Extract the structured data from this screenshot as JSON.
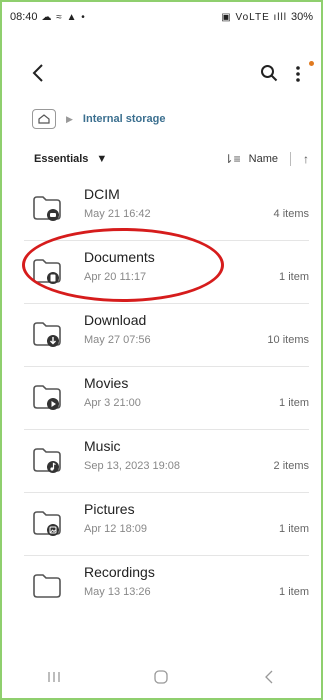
{
  "status": {
    "time": "08:40",
    "left_icons": "☁ ≈ ▲ •",
    "right_icons": "▣ VoLTE ılll",
    "battery": "30%"
  },
  "breadcrumb": {
    "label": "Internal storage"
  },
  "sortbar": {
    "filter_label": "Essentials",
    "sort_label": "Name"
  },
  "items": [
    {
      "name": "DCIM",
      "date": "May 21 16:42",
      "count": "4 items"
    },
    {
      "name": "Documents",
      "date": "Apr 20 11:17",
      "count": "1 item"
    },
    {
      "name": "Download",
      "date": "May 27 07:56",
      "count": "10 items"
    },
    {
      "name": "Movies",
      "date": "Apr 3 21:00",
      "count": "1 item"
    },
    {
      "name": "Music",
      "date": "Sep 13, 2023 19:08",
      "count": "2 items"
    },
    {
      "name": "Pictures",
      "date": "Apr 12 18:09",
      "count": "1 item"
    },
    {
      "name": "Recordings",
      "date": "May 13 13:26",
      "count": "1 item"
    }
  ],
  "colors": {
    "accent": "#3b6f8f",
    "frame": "#8fcf6e",
    "highlight": "#d61c1c",
    "notification_dot": "#e07a20"
  }
}
